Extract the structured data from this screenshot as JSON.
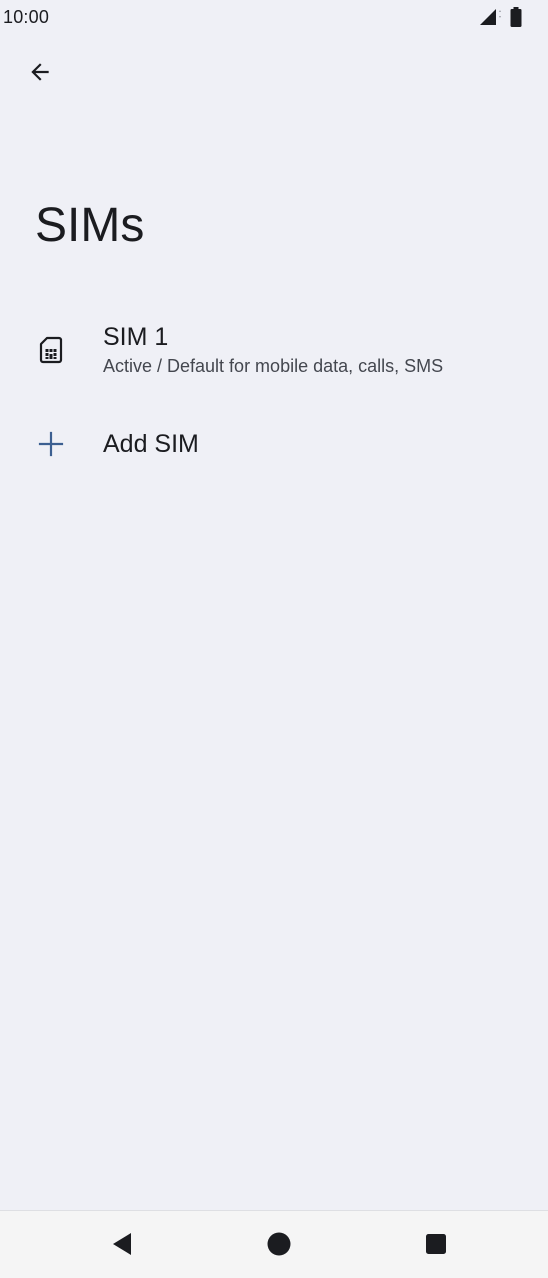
{
  "status_bar": {
    "time": "10:00",
    "icons": [
      "signal-icon",
      "battery-icon"
    ]
  },
  "header": {
    "back_icon": "arrow-back-icon",
    "title": "SIMs"
  },
  "sims": [
    {
      "icon": "sim-card-icon",
      "title": "SIM 1",
      "summary": "Active / Default for mobile data, calls, SMS"
    }
  ],
  "add_sim": {
    "icon": "plus-icon",
    "label": "Add SIM"
  },
  "navigation": {
    "back": "nav-back-icon",
    "home": "nav-home-icon",
    "recents": "nav-recents-icon"
  },
  "colors": {
    "background": "#eff0f6",
    "text_primary": "#1b1c20",
    "text_secondary": "#44474f",
    "accent": "#3c5f91"
  }
}
